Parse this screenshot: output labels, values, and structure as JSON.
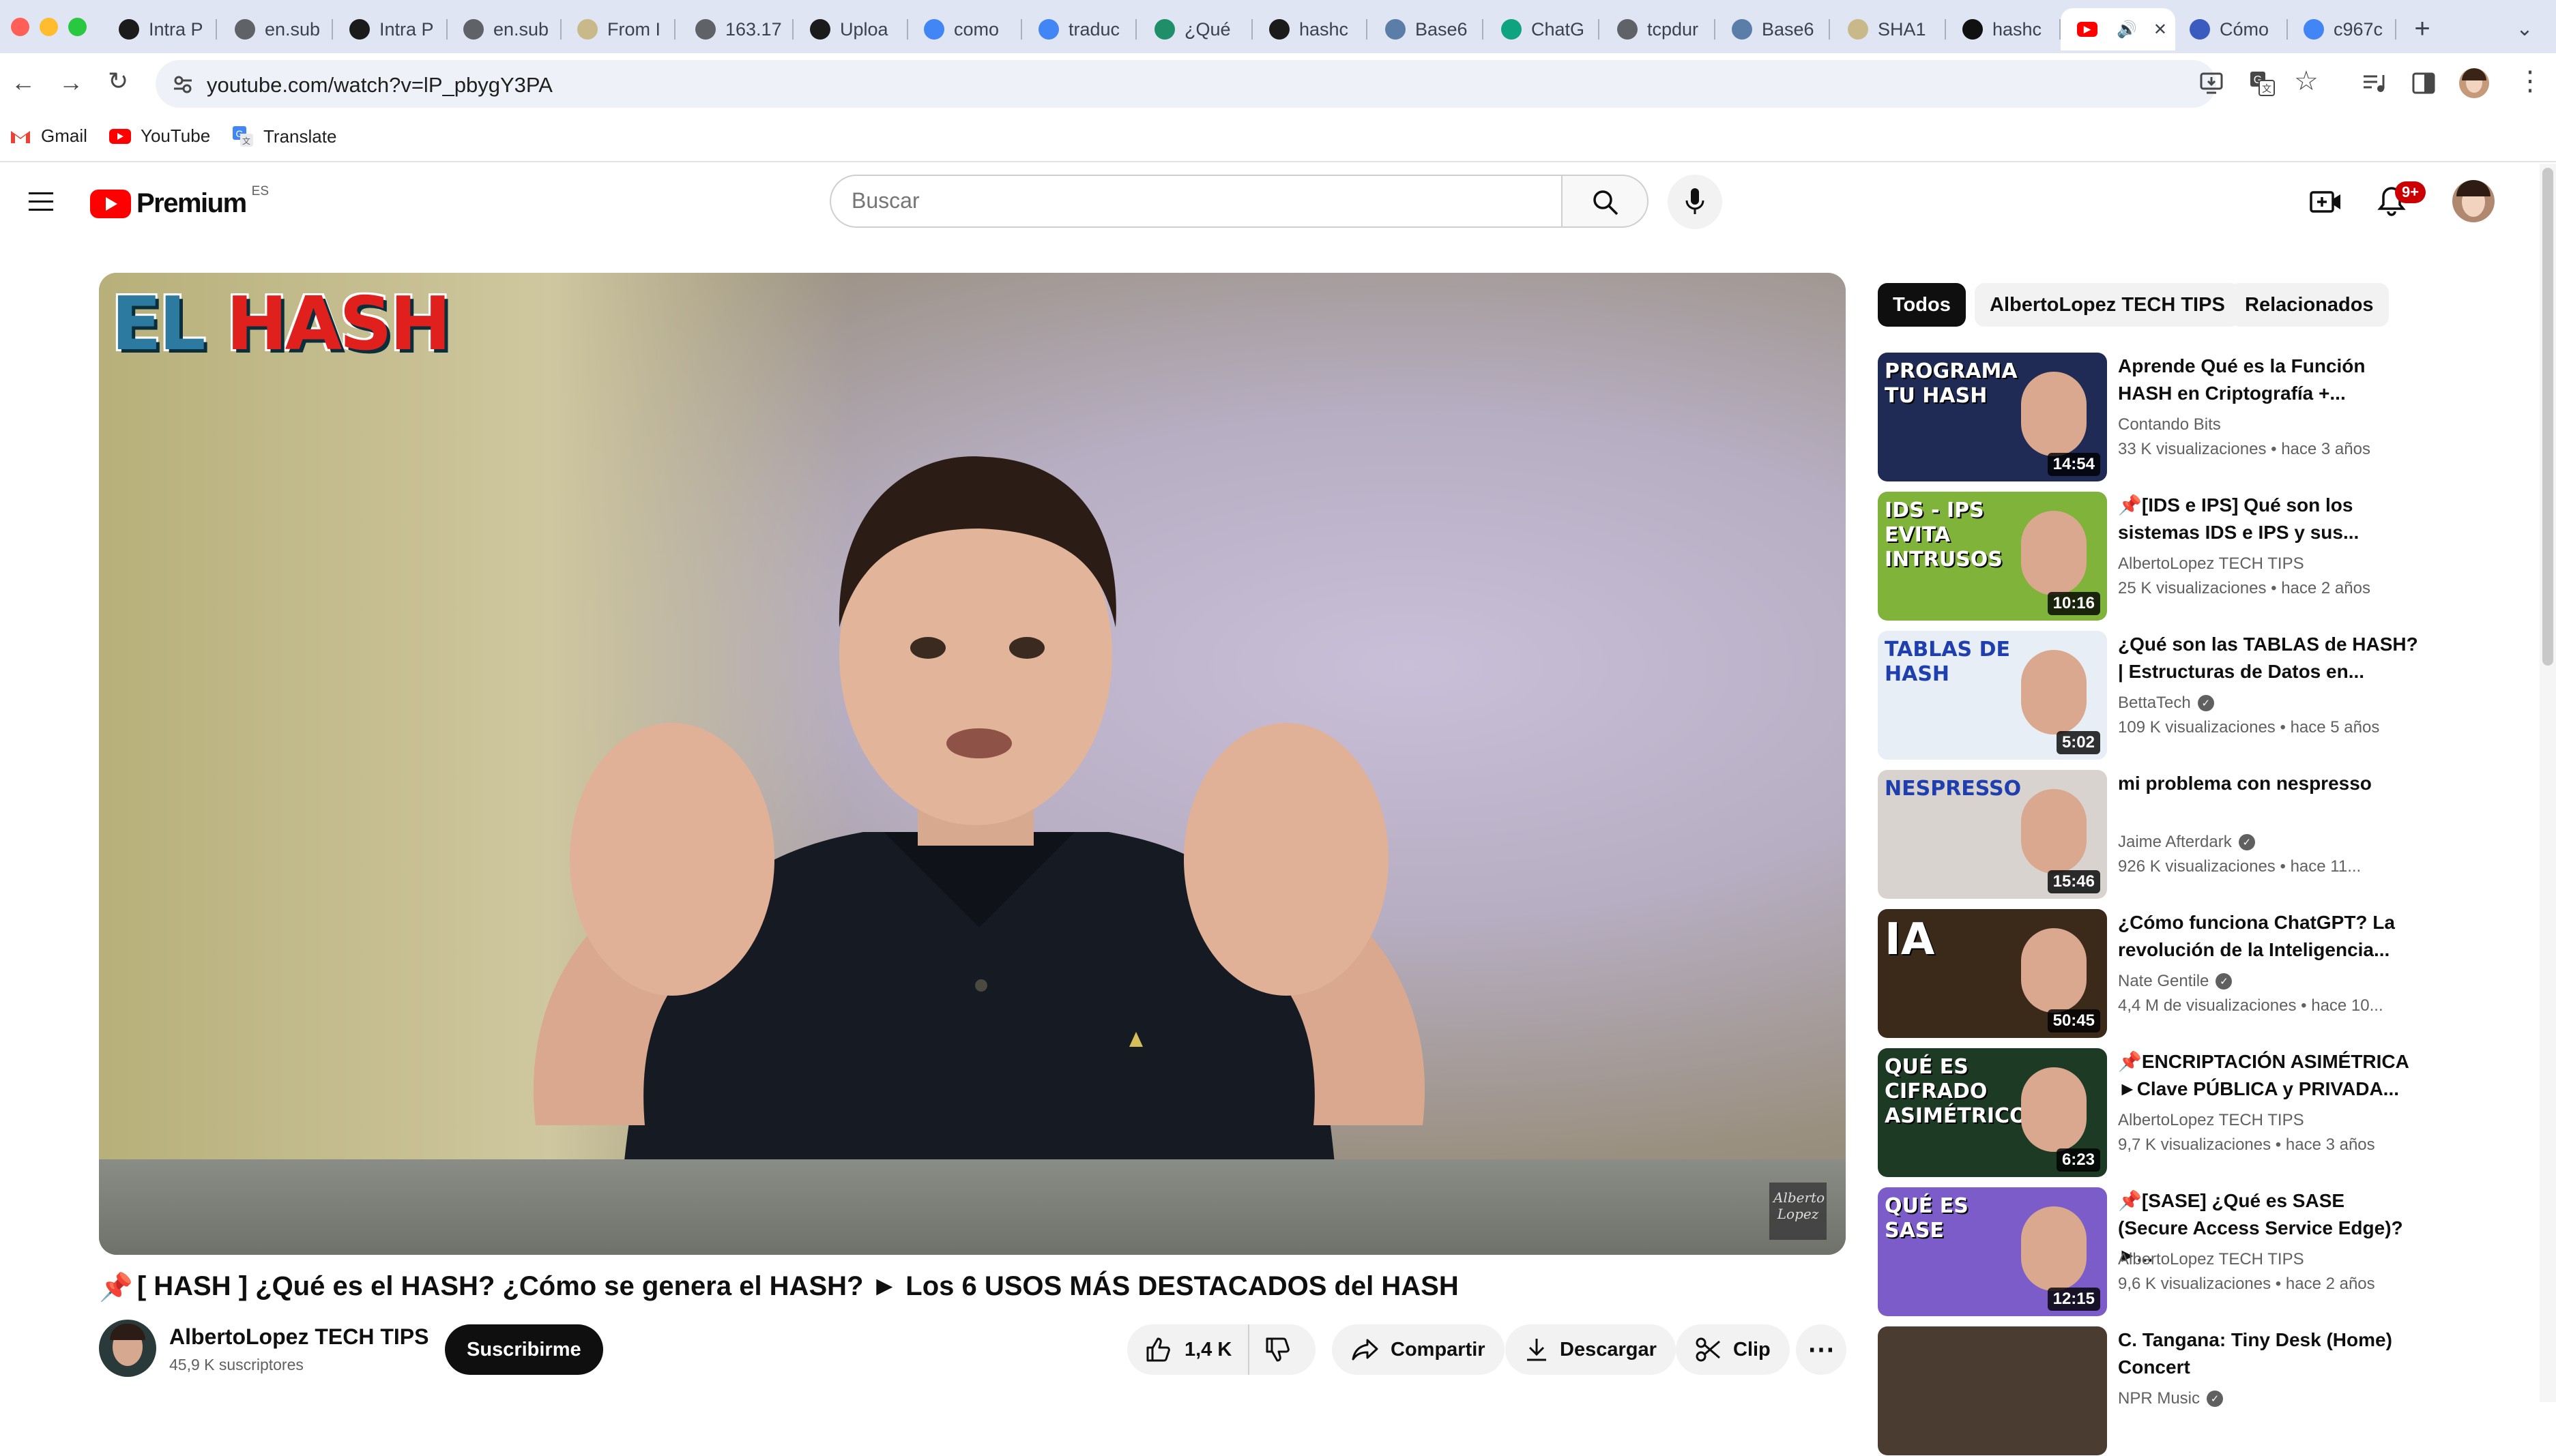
{
  "browser": {
    "traffic_colors": [
      "#ff5f57",
      "#febc2e",
      "#28c840"
    ],
    "tabs": [
      {
        "label": "Intra P",
        "icon": "42-logo-icon",
        "color": "#1b1b1b"
      },
      {
        "label": "en.sub",
        "icon": "globe-icon",
        "color": "#5f6368"
      },
      {
        "label": "Intra P",
        "icon": "42-logo-icon",
        "color": "#1b1b1b"
      },
      {
        "label": "en.sub",
        "icon": "globe-icon",
        "color": "#5f6368"
      },
      {
        "label": "From I",
        "icon": "doc-icon",
        "color": "#c9b98a"
      },
      {
        "label": "163.17",
        "icon": "globe-icon",
        "color": "#5f6368"
      },
      {
        "label": "Uploa",
        "icon": "github-icon",
        "color": "#1b1b1b"
      },
      {
        "label": "como",
        "icon": "google-icon",
        "color": "#4285f4"
      },
      {
        "label": "traduc",
        "icon": "google-icon",
        "color": "#4285f4"
      },
      {
        "label": "¿Qué",
        "icon": "k-logo-icon",
        "color": "#1f8f6a"
      },
      {
        "label": "hashc",
        "icon": "github-icon",
        "color": "#1b1b1b"
      },
      {
        "label": "Base6",
        "icon": "gear-icon",
        "color": "#5b7ea8"
      },
      {
        "label": "ChatG",
        "icon": "chatgpt-icon",
        "color": "#10a37f"
      },
      {
        "label": "tcpdur",
        "icon": "globe-icon",
        "color": "#5f6368"
      },
      {
        "label": "Base6",
        "icon": "gear-icon",
        "color": "#5b7ea8"
      },
      {
        "label": "SHA1",
        "icon": "doc-icon",
        "color": "#c9b98a"
      },
      {
        "label": "hashc",
        "icon": "hashnode-icon",
        "color": "#111111"
      },
      {
        "label": "",
        "icon": "youtube-icon",
        "color": "#ff0000"
      },
      {
        "label": "Cómo",
        "icon": "news-icon",
        "color": "#3a5bbf"
      },
      {
        "label": "c967c",
        "icon": "google-icon",
        "color": "#4285f4"
      }
    ],
    "url": "youtube.com/watch?v=lP_pbygY3PA",
    "bookmarks": [
      {
        "label": "Gmail",
        "icon": "gmail-icon",
        "color": "#ea4335"
      },
      {
        "label": "YouTube",
        "icon": "youtube-icon",
        "color": "#ff0000"
      },
      {
        "label": "Translate",
        "icon": "translate-icon",
        "color": "#4285f4"
      }
    ]
  },
  "youtube": {
    "logo_text": "Premium",
    "region": "ES",
    "search_placeholder": "Buscar",
    "notification_count": "9+",
    "video": {
      "title_emoji": "📌",
      "title": "[ HASH ] ¿Qué es el HASH? ¿Cómo se genera el HASH? ► Los 6 USOS MÁS DESTACADOS del HASH",
      "overlay_el": "EL",
      "overlay_hash": "HASH",
      "watermark": "Alberto Lopez",
      "channel": "AlbertoLopez TECH TIPS",
      "subscribers": "45,9 K suscriptores",
      "subscribe_label": "Suscribirme",
      "likes": "1,4 K",
      "share_label": "Compartir",
      "download_label": "Descargar",
      "clip_label": "Clip"
    },
    "chips": [
      "Todos",
      "AlbertoLopez TECH TIPS",
      "Relacionados"
    ],
    "recommendations": [
      {
        "title": "Aprende Qué es la Función HASH en Criptografía +...",
        "channel": "Contando Bits",
        "verified": false,
        "views": "33 K visualizaciones",
        "age": "hace 3 años",
        "duration": "14:54",
        "thumb_text": "PROGRAMA TU HASH",
        "thumb_bg": "#1f2b55"
      },
      {
        "title": "📌[IDS e IPS] Qué son los sistemas IDS e IPS y sus...",
        "channel": "AlbertoLopez TECH TIPS",
        "verified": false,
        "views": "25 K visualizaciones",
        "age": "hace 2 años",
        "duration": "10:16",
        "thumb_text": "IDS - IPS EVITA INTRUSOS",
        "thumb_bg": "#7fb33a"
      },
      {
        "title": "¿Qué son las TABLAS de HASH? | Estructuras de Datos en...",
        "channel": "BettaTech",
        "verified": true,
        "views": "109 K visualizaciones",
        "age": "hace 5 años",
        "duration": "5:02",
        "thumb_text": "TABLAS DE HASH",
        "thumb_bg": "#e8eef6"
      },
      {
        "title": "mi problema con nespresso",
        "channel": "Jaime Afterdark",
        "verified": true,
        "views": "926 K visualizaciones",
        "age": "hace 11...",
        "duration": "15:46",
        "thumb_text": "NESPRESSO",
        "thumb_bg": "#d8d3cf"
      },
      {
        "title": "¿Cómo funciona ChatGPT? La revolución de la Inteligencia...",
        "channel": "Nate Gentile",
        "verified": true,
        "views": "4,4 M de visualizaciones",
        "age": "hace 10...",
        "duration": "50:45",
        "thumb_text": "IA",
        "thumb_bg": "#3b2a1a"
      },
      {
        "title": "📌ENCRIPTACIÓN ASIMÉTRICA ►Clave PÚBLICA y PRIVADA...",
        "channel": "AlbertoLopez TECH TIPS",
        "verified": false,
        "views": "9,7 K visualizaciones",
        "age": "hace 3 años",
        "duration": "6:23",
        "thumb_text": "QUÉ ES CIFRADO ASIMÉTRICO",
        "thumb_bg": "#1d3a24"
      },
      {
        "title": "📌[SASE] ¿Qué es SASE (Secure Access Service Edge)? ►...",
        "channel": "AlbertoLopez TECH TIPS",
        "verified": false,
        "views": "9,6 K visualizaciones",
        "age": "hace 2 años",
        "duration": "12:15",
        "thumb_text": "QUÉ ES SASE",
        "thumb_bg": "#7b5cc8"
      },
      {
        "title": "C. Tangana: Tiny Desk (Home) Concert",
        "channel": "NPR Music",
        "verified": true,
        "views": "",
        "age": "",
        "duration": "",
        "thumb_text": "",
        "thumb_bg": "#4a3c30"
      }
    ]
  }
}
